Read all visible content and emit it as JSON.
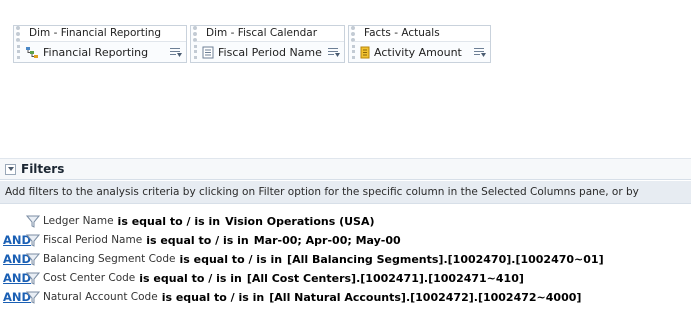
{
  "selected_columns": [
    {
      "folder": "Dim - Financial Reporting",
      "column": "Financial Reporting",
      "icon": "hierarchy-icon"
    },
    {
      "folder": "Dim - Fiscal Calendar",
      "column": "Fiscal Period Name",
      "icon": "attribute-column-icon"
    },
    {
      "folder": "Facts - Actuals",
      "column": "Activity Amount",
      "icon": "measure-column-icon"
    }
  ],
  "filters": {
    "title": "Filters",
    "hint": "Add filters to the analysis criteria by clicking on Filter option for the specific column in the Selected Columns pane, or by",
    "rows": [
      {
        "connector": "",
        "column": "Ledger Name",
        "operator": "is equal to / is in",
        "value": "Vision Operations (USA)"
      },
      {
        "connector": "AND",
        "column": "Fiscal Period Name",
        "operator": "is equal to / is in",
        "value": "Mar-00; Apr-00; May-00"
      },
      {
        "connector": "AND",
        "column": "Balancing Segment Code",
        "operator": "is equal to / is in",
        "value": "[All Balancing Segments].[1002470].[1002470~01]"
      },
      {
        "connector": "AND",
        "column": "Cost Center Code",
        "operator": "is equal to / is in",
        "value": "[All Cost Centers].[1002471].[1002471~410]"
      },
      {
        "connector": "AND",
        "column": "Natural Account Code",
        "operator": "is equal to / is in",
        "value": "[All Natural Accounts].[1002472].[1002472~4000]"
      }
    ]
  }
}
